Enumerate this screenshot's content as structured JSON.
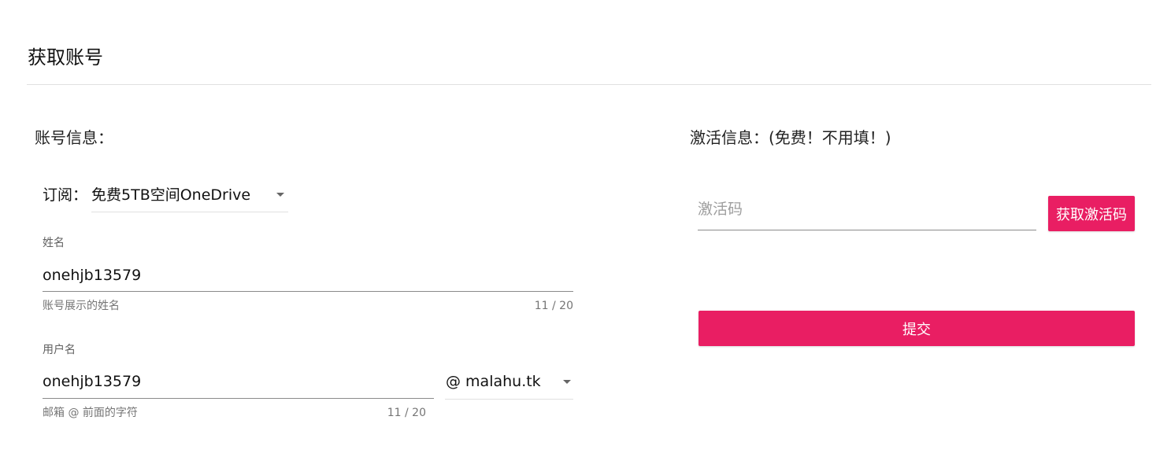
{
  "page": {
    "title": "获取账号"
  },
  "account_section": {
    "title": "账号信息：",
    "subscription": {
      "label": "订阅：",
      "value": "免费5TB空间OneDrive"
    },
    "name_field": {
      "label": "姓名",
      "value": "onehjb13579",
      "helper": "账号展示的姓名",
      "counter": "11 / 20"
    },
    "username_field": {
      "label": "用户名",
      "value": "onehjb13579",
      "helper": "邮箱 @ 前面的字符",
      "counter": "11 / 20"
    },
    "domain_select": {
      "value": "@ malahu.tk"
    }
  },
  "activation_section": {
    "title": "激活信息：(免费！不用填！)",
    "code_input": {
      "placeholder": "激活码",
      "value": ""
    },
    "get_code_button": "获取激活码",
    "submit_button": "提交"
  },
  "colors": {
    "accent": "#e91e63",
    "divider": "#e0e0e0"
  }
}
